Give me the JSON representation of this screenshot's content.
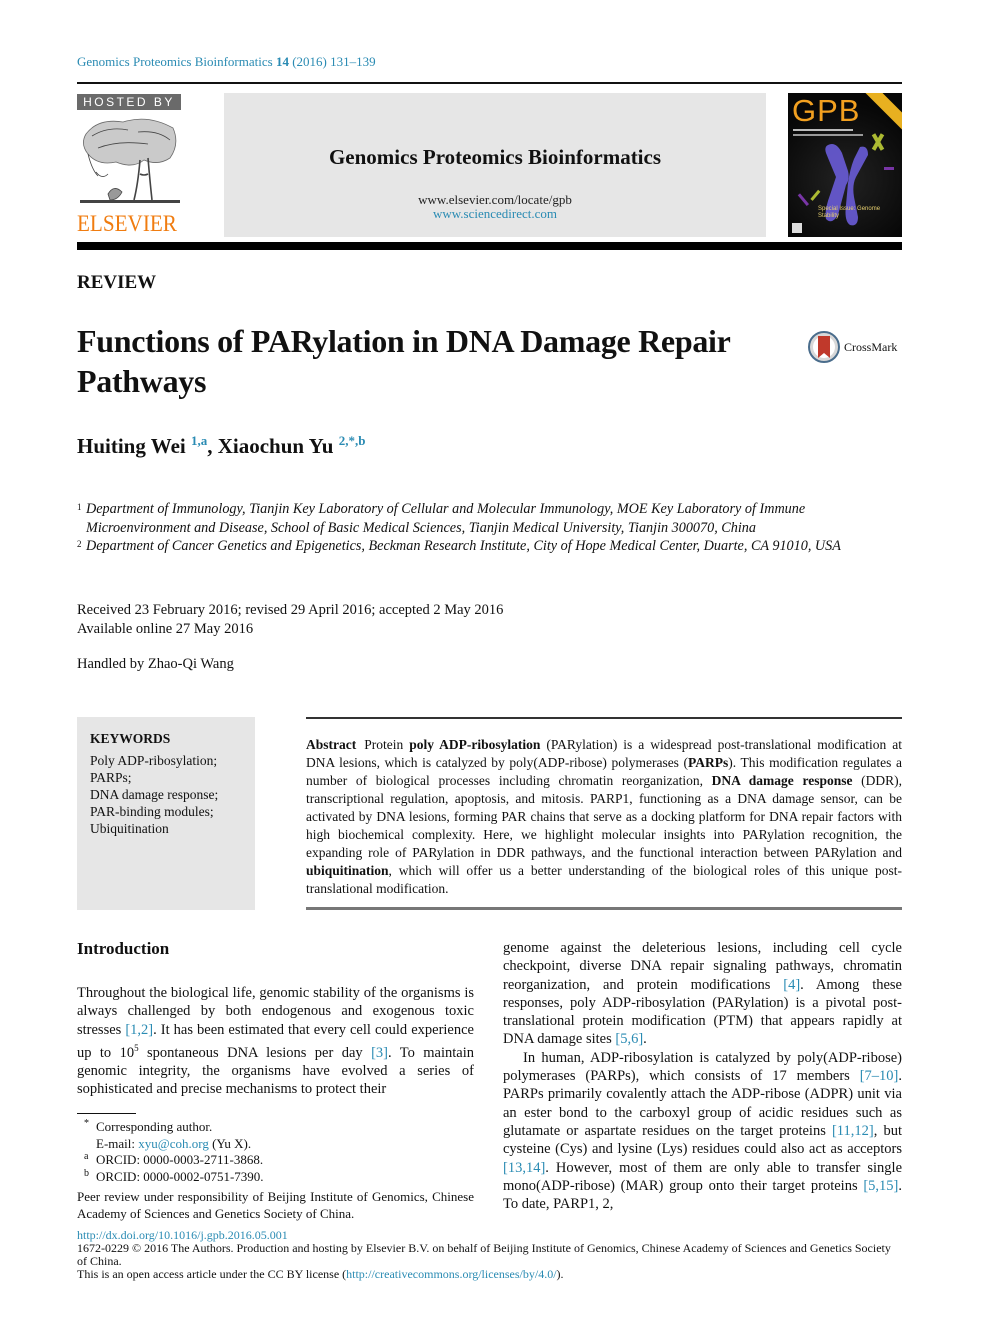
{
  "header": {
    "journal": "Genomics Proteomics Bioinformatics",
    "volume": "14",
    "year_pages": "(2016) 131–139",
    "hosted_by": "HOSTED BY",
    "publisher": "ELSEVIER",
    "banner_title": "Genomics Proteomics Bioinformatics",
    "banner_url1": "www.elsevier.com/locate/gpb",
    "banner_url2": "www.sciencedirect.com",
    "cover_title": "GPB",
    "cover_special": "Special Issue: Genome Stability"
  },
  "article": {
    "section": "REVIEW",
    "title": "Functions of PARylation in DNA Damage Repair Pathways",
    "crossmark": "CrossMark",
    "authors": [
      {
        "name": "Huiting Wei",
        "marks": "1,a"
      },
      {
        "name": "Xiaochun Yu",
        "marks": "2,*,b"
      }
    ],
    "author_separator": ", ",
    "affiliations": [
      {
        "num": "1",
        "text": "Department of Immunology, Tianjin Key Laboratory of Cellular and Molecular Immunology, MOE Key Laboratory of Immune Microenvironment and Disease, School of Basic Medical Sciences, Tianjin Medical University, Tianjin 300070, China"
      },
      {
        "num": "2",
        "text": "Department of Cancer Genetics and Epigenetics, Beckman Research Institute, City of Hope Medical Center, Duarte, CA 91010, USA"
      }
    ],
    "dates_line1": "Received 23 February 2016; revised 29 April 2016; accepted 2 May 2016",
    "dates_line2": "Available online 27 May 2016",
    "handled_by": "Handled by Zhao-Qi Wang"
  },
  "keywords": {
    "title": "KEYWORDS",
    "items": [
      "Poly ADP-ribosylation;",
      "PARPs;",
      "DNA damage response;",
      "PAR-binding modules;",
      "Ubiquitination"
    ]
  },
  "abstract": {
    "label": "Abstract",
    "segments": [
      {
        "t": "Protein ",
        "b": false
      },
      {
        "t": "poly ADP-ribosylation",
        "b": true
      },
      {
        "t": " (PARylation) is a widespread post-translational modification at DNA lesions, which is catalyzed by poly(ADP-ribose) polymerases (",
        "b": false
      },
      {
        "t": "PARPs",
        "b": true
      },
      {
        "t": "). This modification regulates a number of biological processes including chromatin reorganization, ",
        "b": false
      },
      {
        "t": "DNA damage response",
        "b": true
      },
      {
        "t": " (DDR), transcriptional regulation, apoptosis, and mitosis. PARP1, functioning as a DNA damage sensor, can be activated by DNA lesions, forming PAR chains that serve as a docking platform for DNA repair factors with high biochemical complexity. Here, we highlight molecular insights into PARylation recognition, the expanding role of PARylation in DDR pathways, and the functional interaction between PARylation and ",
        "b": false
      },
      {
        "t": "ubiquitination",
        "b": true
      },
      {
        "t": ", which will offer us a better understanding of the biological roles of this unique post-translational modification.",
        "b": false
      }
    ]
  },
  "introduction": {
    "heading": "Introduction",
    "left_segments": [
      {
        "t": "Throughout the biological life, genomic stability of the organisms is always challenged by both endogenous and exogenous toxic stresses ",
        "k": "text"
      },
      {
        "t": "[1,2]",
        "k": "ref"
      },
      {
        "t": ". It has been estimated that every cell could experience up to 10",
        "k": "text"
      },
      {
        "t": "5",
        "k": "sup"
      },
      {
        "t": " spontaneous DNA lesions per day ",
        "k": "text"
      },
      {
        "t": "[3]",
        "k": "ref"
      },
      {
        "t": ". To maintain genomic integrity, the organisms have evolved a series of sophisticated and precise mechanisms to protect their",
        "k": "text"
      }
    ],
    "right_p1": [
      {
        "t": "genome against the deleterious lesions, including cell cycle checkpoint, diverse DNA repair signaling pathways, chromatin reorganization, and protein modifications ",
        "k": "text"
      },
      {
        "t": "[4]",
        "k": "ref"
      },
      {
        "t": ". Among these responses, poly ADP-ribosylation (PARylation) is a pivotal post-translational protein modification (PTM) that appears rapidly at DNA damage sites ",
        "k": "text"
      },
      {
        "t": "[5,6]",
        "k": "ref"
      },
      {
        "t": ".",
        "k": "text"
      }
    ],
    "right_p2": [
      {
        "t": "In human, ADP-ribosylation is catalyzed by poly(ADP-ribose) polymerases (PARPs), which consists of 17 members ",
        "k": "text"
      },
      {
        "t": "[7–10]",
        "k": "ref"
      },
      {
        "t": ". PARPs primarily covalently attach the ADP-ribose (ADPR) unit via an ester bond to the carboxyl group of acidic residues such as glutamate or aspartate residues on the target proteins ",
        "k": "text"
      },
      {
        "t": "[11,12]",
        "k": "ref"
      },
      {
        "t": ", but cysteine (Cys) and lysine (Lys) residues could also act as acceptors ",
        "k": "text"
      },
      {
        "t": "[13,14]",
        "k": "ref"
      },
      {
        "t": ". However, most of them are only able to transfer single mono(ADP-ribose) (MAR) group onto their target proteins ",
        "k": "text"
      },
      {
        "t": "[5,15]",
        "k": "ref"
      },
      {
        "t": ". To date, PARP1, 2,",
        "k": "text"
      }
    ]
  },
  "footnotes": {
    "corresponding_mark": "*",
    "corresponding": "Corresponding author.",
    "email_label": "E-mail: ",
    "email": "xyu@coh.org",
    "email_suffix": " (Yu X).",
    "orcid_a_mark": "a",
    "orcid_a": "ORCID: 0000-0003-2711-3868.",
    "orcid_b_mark": "b",
    "orcid_b": "ORCID: 0000-0002-0751-7390.",
    "peer_review": "Peer review under responsibility of Beijing Institute of Genomics, Chinese Academy of Sciences and Genetics Society of China."
  },
  "footer": {
    "doi": "http://dx.doi.org/10.1016/j.gpb.2016.05.001",
    "copyright": "1672-0229 © 2016 The Authors. Production and hosting by Elsevier B.V. on behalf of Beijing Institute of Genomics, Chinese Academy of Sciences and Genetics Society of China.",
    "license_prefix": "This is an open access article under the CC BY license (",
    "license_url": "http://creativecommons.org/licenses/by/4.0/",
    "license_suffix": ")."
  },
  "colors": {
    "link": "#2a8bb3",
    "elsevier_orange": "#f07c10",
    "banner_gray": "#e6e6e6"
  }
}
